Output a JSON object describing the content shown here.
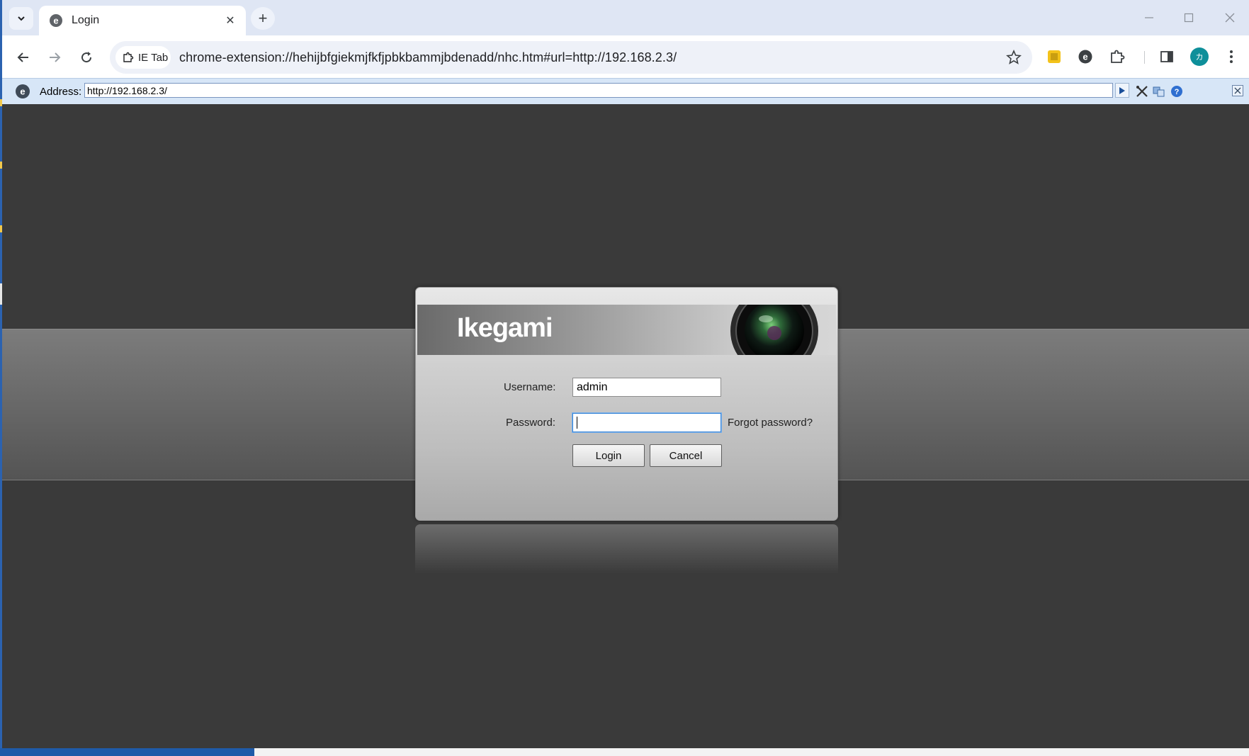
{
  "browser": {
    "tab": {
      "title": "Login",
      "close_glyph": "✕"
    },
    "new_tab_glyph": "+",
    "tab_search_glyph": "⌄",
    "window_controls": {
      "minimize": "—",
      "maximize": "☐",
      "close": "✕"
    },
    "omnibox": {
      "chip_label": "IE Tab",
      "url": "chrome-extension://hehijbfgiekmjfkfjpbkbammjbdenadd/nhc.htm#url=http://192.168.2.3/"
    },
    "avatar_initial": "カ"
  },
  "ie_tab": {
    "address_label": "Address:",
    "address_value": "http://192.168.2.3/"
  },
  "login": {
    "brand": "Ikegami",
    "username_label": "Username:",
    "username_value": "admin",
    "password_label": "Password:",
    "password_value": "",
    "forgot_password": "Forgot password?",
    "login_button": "Login",
    "cancel_button": "Cancel"
  },
  "colors": {
    "background": "#3a3a3a",
    "band": "#6a6a6a",
    "ie_bar": "#d7e6f7",
    "focus": "#3b86d6"
  }
}
